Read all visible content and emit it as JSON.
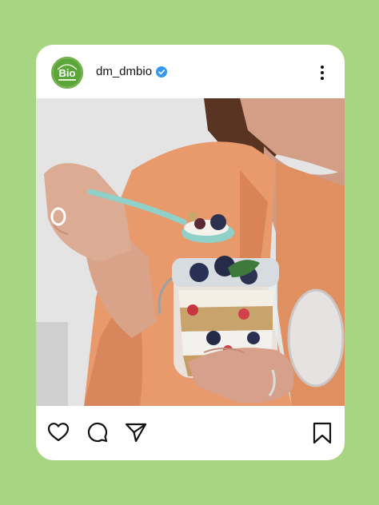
{
  "post": {
    "username": "dm_dmbio",
    "verified": true,
    "avatar_text": "Bio"
  },
  "icons": {
    "avatar": "dmbio-logo-icon",
    "verified": "verified-badge-icon",
    "more": "more-options-icon",
    "like": "heart-icon",
    "comment": "comment-bubble-icon",
    "share": "send-paper-plane-icon",
    "save": "bookmark-icon"
  },
  "colors": {
    "background": "#a8d582",
    "card": "#ffffff",
    "verified": "#3897f0",
    "icon": "#111111"
  }
}
